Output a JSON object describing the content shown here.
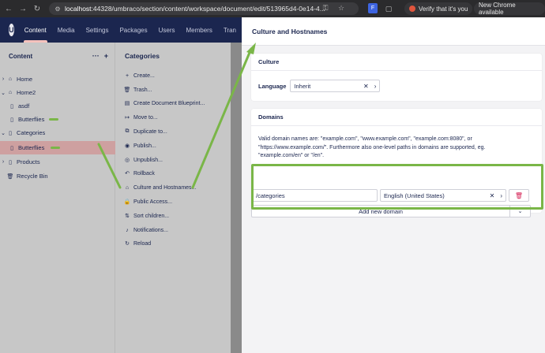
{
  "browser": {
    "url_host": "localhost",
    "url_rest": ":44328/umbraco/section/content/workspace/document/edit/513965d4-0e14-4...",
    "verify_label": "Verify that it's you",
    "update_label": "New Chrome available"
  },
  "header": {
    "tabs": [
      "Content",
      "Media",
      "Settings",
      "Packages",
      "Users",
      "Members",
      "Tran"
    ]
  },
  "tree": {
    "title": "Content",
    "items": [
      {
        "label": "Home"
      },
      {
        "label": "Home2"
      },
      {
        "label": "asdf"
      },
      {
        "label": "Butterflies"
      },
      {
        "label": "Categories"
      },
      {
        "label": "Butterflies"
      },
      {
        "label": "Products"
      },
      {
        "label": "Recycle Bin"
      }
    ]
  },
  "actions_panel": {
    "title": "Categories",
    "items": [
      "Create...",
      "Trash...",
      "Create Document Blueprint...",
      "Move to...",
      "Duplicate to...",
      "Publish...",
      "Unpublish...",
      "Rollback",
      "Culture and Hostnames...",
      "Public Access...",
      "Sort children...",
      "Notifications...",
      "Reload"
    ]
  },
  "dialog": {
    "title": "Culture and Hostnames",
    "culture": {
      "heading": "Culture",
      "language_label": "Language",
      "language_value": "Inherit"
    },
    "domains": {
      "heading": "Domains",
      "description": "Valid domain names are: \"example.com\", \"www.example.com\", \"example.com:8080\", or \"https://www.example.com/\". Furthermore also one-level paths in domains are supported, eg. \"example.com/en\" or \"/en\".",
      "domain_value": "/categories",
      "domain_language": "English (United States)",
      "add_label": "Add new domain"
    }
  },
  "colors": {
    "header_bg": "#1b264f",
    "highlight": "#7ab648",
    "danger": "#d42054"
  }
}
